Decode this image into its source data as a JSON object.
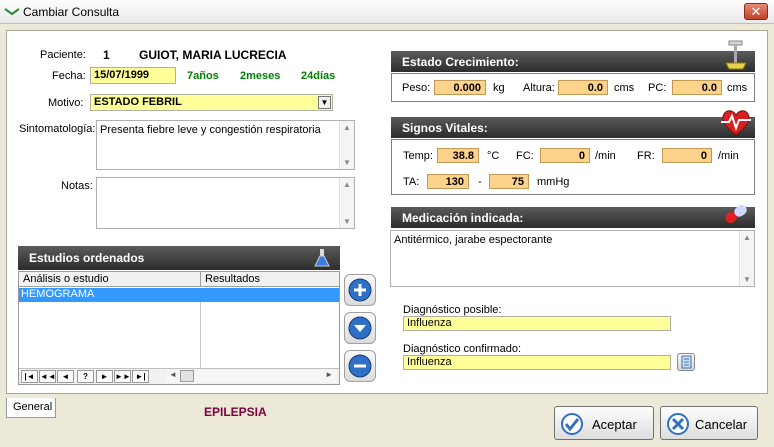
{
  "window": {
    "title": "Cambiar Consulta"
  },
  "patient": {
    "label": "Paciente:",
    "id": "1",
    "name": "GUIOT, MARIA LUCRECIA"
  },
  "date": {
    "label": "Fecha:",
    "value": "15/07/1999",
    "years": "7años",
    "months": "2meses",
    "days": "24días"
  },
  "motivo": {
    "label": "Motivo:",
    "value": "ESTADO FEBRIL"
  },
  "sintomatologia": {
    "label": "Sintomatología:",
    "value": "Presenta fiebre leve y congestión respiratoria"
  },
  "notas": {
    "label": "Notas:",
    "value": ""
  },
  "estudios": {
    "title": "Estudios ordenados",
    "columns": [
      "Análisis o estudio",
      "Resultados"
    ],
    "rows": [
      {
        "estudio": "HEMOGRAMA",
        "resultado": ""
      }
    ],
    "nav": [
      "|◄",
      "◄◄",
      "◄",
      "?",
      "►",
      "►►",
      "►|"
    ]
  },
  "crecimiento": {
    "title": "Estado Crecimiento:",
    "peso_label": "Peso:",
    "peso": "0.000",
    "peso_unit": "kg",
    "altura_label": "Altura:",
    "altura": "0.0",
    "altura_unit": "cms",
    "pc_label": "PC:",
    "pc": "0.0",
    "pc_unit": "cms"
  },
  "vitales": {
    "title": "Signos Vitales:",
    "temp_label": "Temp:",
    "temp": "38.8",
    "temp_unit": "°C",
    "fc_label": "FC:",
    "fc": "0",
    "fc_unit": "/min",
    "fr_label": "FR:",
    "fr": "0",
    "fr_unit": "/min",
    "ta_label": "TA:",
    "ta_sys": "130",
    "ta_sep": "-",
    "ta_dia": "75",
    "ta_unit": "mmHg"
  },
  "medicacion": {
    "title": "Medicación indicada:",
    "value": "Antitérmico, jarabe espectorante"
  },
  "diagnostico": {
    "posible_label": "Diagnóstico posible:",
    "posible": "Influenza",
    "confirmado_label": "Diagnóstico confirmado:",
    "confirmado": "Influenza"
  },
  "footer": {
    "tab": "General",
    "alert": "EPILEPSIA",
    "accept": "Aceptar",
    "cancel": "Cancelar"
  },
  "colors": {
    "field_yellow": "#ffff99",
    "field_orange": "#fdd28b",
    "section_header": "#3a3a3a",
    "selection": "#3399ff",
    "alert": "#800040",
    "age_green": "#008000"
  }
}
